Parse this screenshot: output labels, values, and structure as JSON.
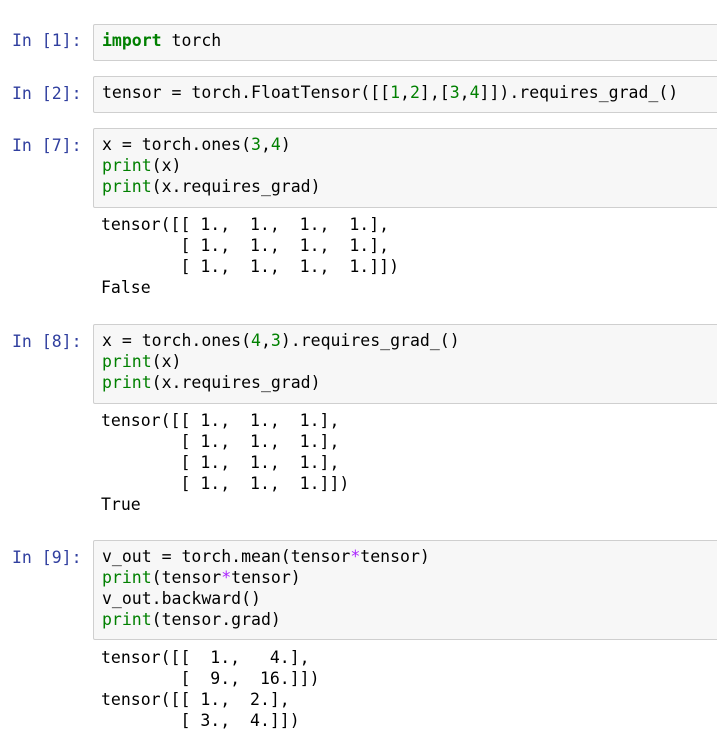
{
  "cells": [
    {
      "prompt": "In [1]:",
      "input": [
        [
          [
            "kw",
            "import"
          ],
          [
            "t",
            " torch"
          ]
        ]
      ],
      "output": []
    },
    {
      "prompt": "In [2]:",
      "input": [
        [
          [
            "t",
            "tensor = torch.FloatTensor([["
          ],
          [
            "num",
            "1"
          ],
          [
            "t",
            ","
          ],
          [
            "num",
            "2"
          ],
          [
            "t",
            "],["
          ],
          [
            "num",
            "3"
          ],
          [
            "t",
            ","
          ],
          [
            "num",
            "4"
          ],
          [
            "t",
            "]]).requires_grad_()"
          ]
        ]
      ],
      "output": []
    },
    {
      "prompt": "In [7]:",
      "input": [
        [
          [
            "t",
            "x = torch.ones("
          ],
          [
            "num",
            "3"
          ],
          [
            "t",
            ","
          ],
          [
            "num",
            "4"
          ],
          [
            "t",
            ")"
          ]
        ],
        [
          [
            "bi",
            "print"
          ],
          [
            "t",
            "(x)"
          ]
        ],
        [
          [
            "bi",
            "print"
          ],
          [
            "t",
            "(x.requires_grad)"
          ]
        ]
      ],
      "output": [
        "tensor([[ 1.,  1.,  1.,  1.],",
        "        [ 1.,  1.,  1.,  1.],",
        "        [ 1.,  1.,  1.,  1.]])",
        "False"
      ]
    },
    {
      "prompt": "In [8]:",
      "input": [
        [
          [
            "t",
            "x = torch.ones("
          ],
          [
            "num",
            "4"
          ],
          [
            "t",
            ","
          ],
          [
            "num",
            "3"
          ],
          [
            "t",
            ").requires_grad_()"
          ]
        ],
        [
          [
            "bi",
            "print"
          ],
          [
            "t",
            "(x)"
          ]
        ],
        [
          [
            "bi",
            "print"
          ],
          [
            "t",
            "(x.requires_grad)"
          ]
        ]
      ],
      "output": [
        "tensor([[ 1.,  1.,  1.],",
        "        [ 1.,  1.,  1.],",
        "        [ 1.,  1.,  1.],",
        "        [ 1.,  1.,  1.]])",
        "True"
      ]
    },
    {
      "prompt": "In [9]:",
      "input": [
        [
          [
            "t",
            "v_out = torch.mean(tensor"
          ],
          [
            "op",
            "*"
          ],
          [
            "t",
            "tensor)"
          ]
        ],
        [
          [
            "bi",
            "print"
          ],
          [
            "t",
            "(tensor"
          ],
          [
            "op",
            "*"
          ],
          [
            "t",
            "tensor)"
          ]
        ],
        [
          [
            "t",
            "v_out.backward()"
          ]
        ],
        [
          [
            "bi",
            "print"
          ],
          [
            "t",
            "(tensor.grad)"
          ]
        ]
      ],
      "output": [
        "tensor([[  1.,   4.],",
        "        [  9.,  16.]])",
        "tensor([[ 1.,  2.],",
        "        [ 3.,  4.]])"
      ]
    }
  ]
}
